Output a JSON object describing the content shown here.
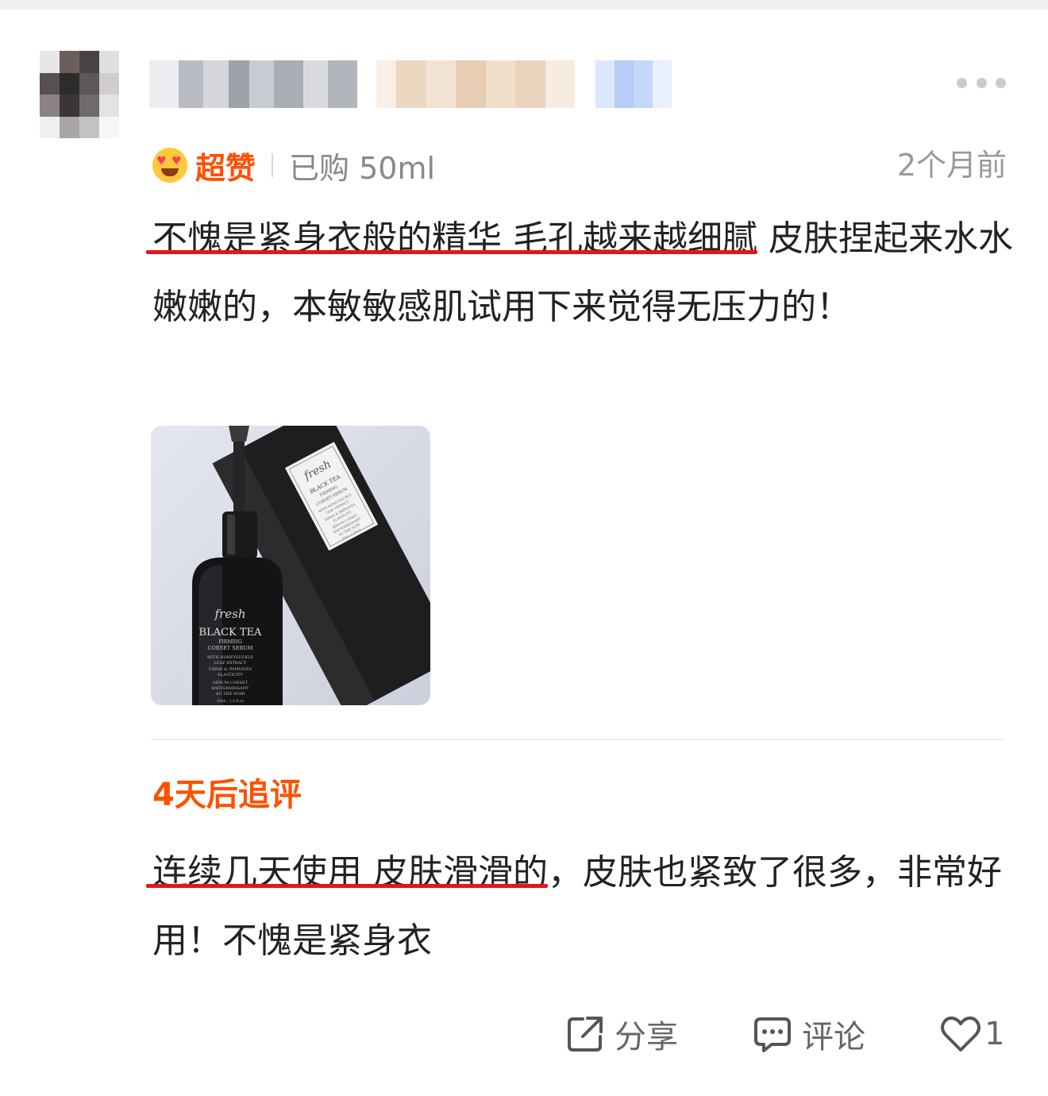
{
  "rating": {
    "emoji_icon": "heart-eyes-emoji-icon",
    "label": "超赞"
  },
  "purchase": "已购 50ml",
  "time": "2个月前",
  "review": {
    "highlight": "不愧是紧身衣般的精华 毛孔越来越细腻",
    "rest": " 皮肤捏起来水水嫩嫩的，本敏敏感肌试用下来觉得无压力的！"
  },
  "photo": {
    "bottle_brand": "fresh",
    "bottle_lines": [
      "BLACK TEA",
      "FIRMING",
      "CORSET SERUM",
      "WITH HONEYSUCKLE",
      "LEAF EXTRACT",
      "FIRMS & IMPROVES",
      "ELASTICITY",
      "SÉRUM CORSET",
      "RAFFERMISSANT",
      "AU THÉ NOIR",
      "50ml - 1.6 fl.oz"
    ],
    "box_brand": "fresh",
    "box_lines": [
      "BLACK TEA",
      "FIRMING",
      "CORSET SERUM",
      "WITH HONEYSUCKLE",
      "LEAF EXTRACT",
      "FIRMS & IMPROVES",
      "ELASTICITY",
      "SÉRUM CORSET",
      "RAFFERMISSANT",
      "AU THÉ NOIR",
      "50ml - 1.6 fl.oz"
    ]
  },
  "followup": {
    "title": "4天后追评",
    "highlight": "连续几天使用 皮肤滑滑的",
    "rest": "，皮肤也紧致了很多，非常好用！不愧是紧身衣"
  },
  "actions": {
    "share_label": "分享",
    "comment_label": "评论",
    "like_count": "1"
  },
  "colors": {
    "accent": "#ff5000",
    "underline": "#e5141e",
    "muted": "#999999"
  }
}
